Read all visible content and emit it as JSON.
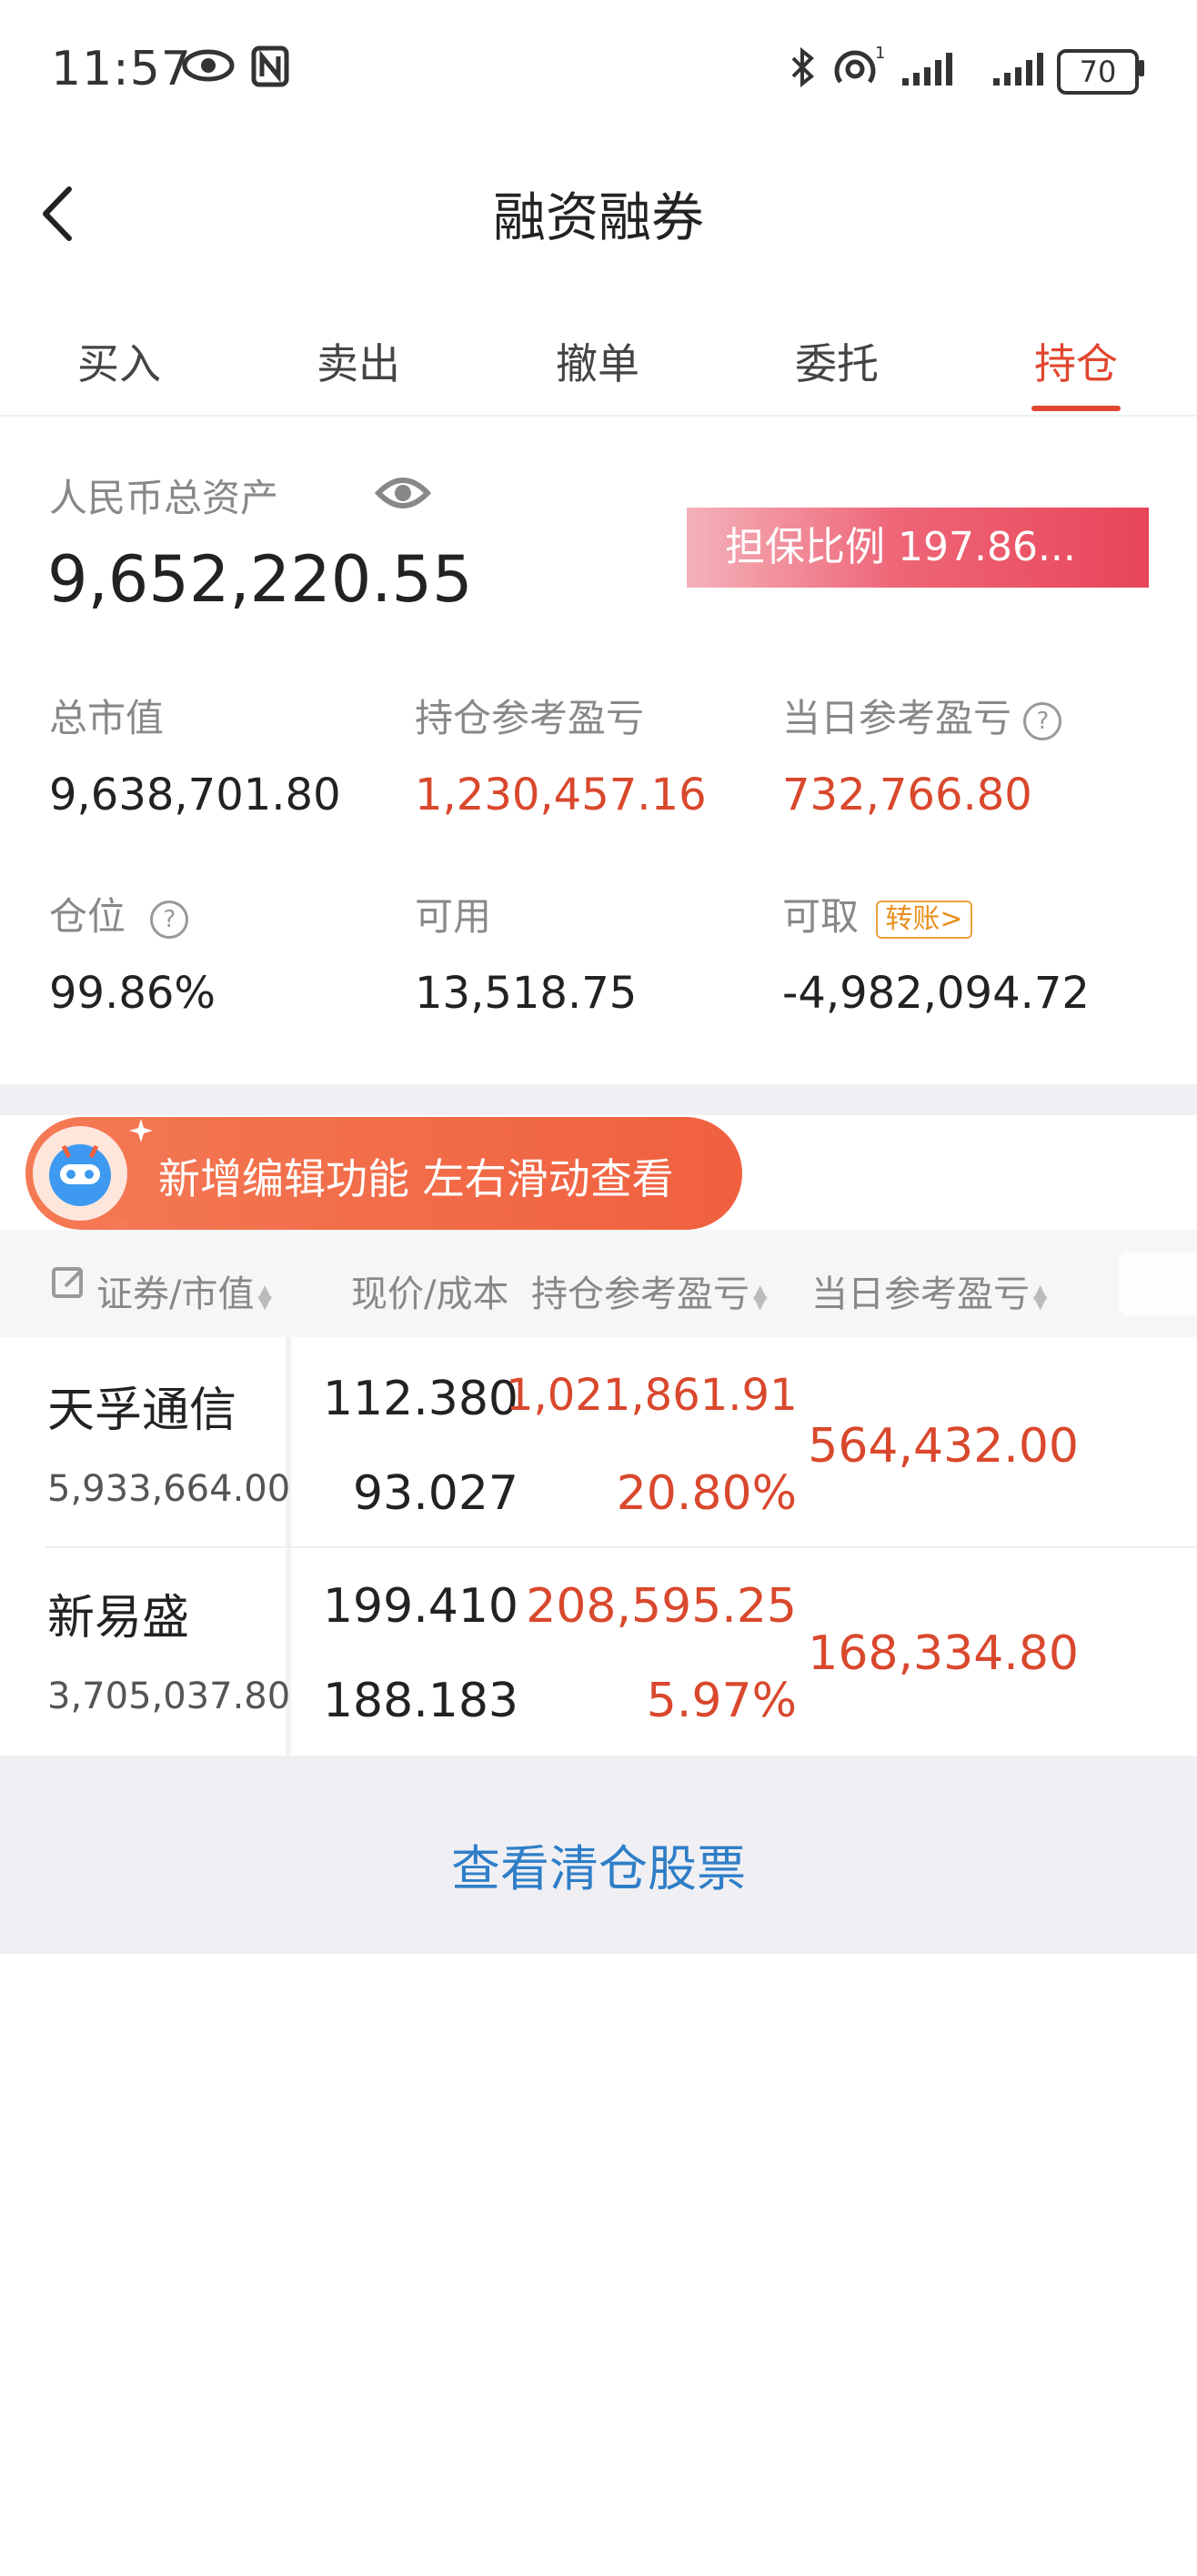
{
  "status_bar": {
    "time": "11:57",
    "battery": "70"
  },
  "header": {
    "title": "融资融券"
  },
  "tabs": [
    {
      "label": "买入"
    },
    {
      "label": "卖出"
    },
    {
      "label": "撤单"
    },
    {
      "label": "委托"
    },
    {
      "label": "持仓"
    }
  ],
  "active_tab": "持仓",
  "assets": {
    "total_label": "人民币总资产",
    "total_value": "9,652,220.55",
    "ratio_text": "担保比例 197.86...",
    "market_value_label": "总市值",
    "market_value": "9,638,701.80",
    "position_pl_label": "持仓参考盈亏",
    "position_pl": "1,230,457.16",
    "daily_pl_label": "当日参考盈亏",
    "daily_pl": "732,766.80",
    "position_label": "仓位",
    "position": "99.86%",
    "available_label": "可用",
    "available": "13,518.75",
    "withdrawable_label": "可取",
    "transfer_label": "转账",
    "withdrawable": "-4,982,094.72"
  },
  "tooltip": {
    "text": "新增编辑功能 左右滑动查看"
  },
  "table": {
    "headers": {
      "security": "证券/市值",
      "price_cost": "现价/成本",
      "position_pl": "持仓参考盈亏",
      "daily_pl": "当日参考盈亏"
    },
    "rows": [
      {
        "name": "天孚通信",
        "market_value": "5,933,664.00",
        "price": "112.380",
        "cost": "93.027",
        "pl": "1,021,861.91",
        "pl_pct": "20.80%",
        "daily_pl": "564,432.00"
      },
      {
        "name": "新易盛",
        "market_value": "3,705,037.80",
        "price": "199.410",
        "cost": "188.183",
        "pl": "208,595.25",
        "pl_pct": "5.97%",
        "daily_pl": "168,334.80"
      }
    ]
  },
  "footer": {
    "link_label": "查看清仓股票"
  },
  "colors": {
    "accent": "#e1462e",
    "profit": "#d9482d",
    "link": "#2f7ec7"
  }
}
